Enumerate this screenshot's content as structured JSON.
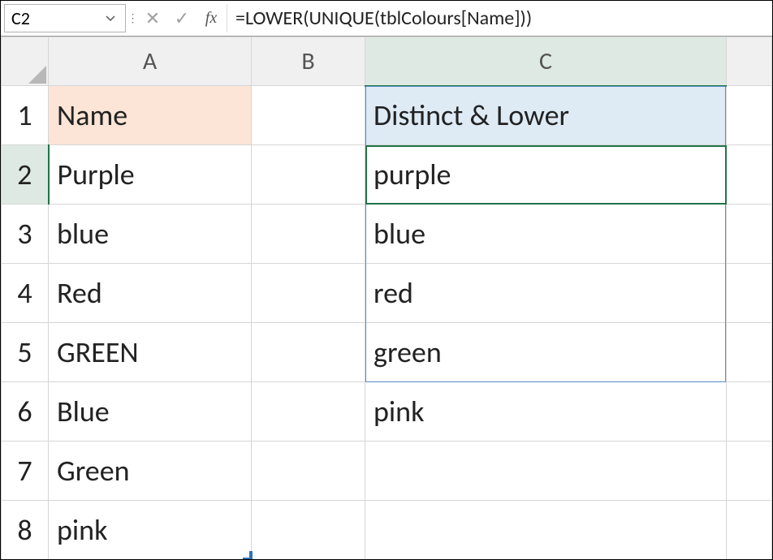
{
  "formula_bar": {
    "name_box": "C2",
    "cancel_icon": "✕",
    "confirm_icon": "✓",
    "fx_label": "fx",
    "formula": "=LOWER(UNIQUE(tblColours[Name]))"
  },
  "columns": {
    "A": "A",
    "B": "B",
    "C": "C"
  },
  "row_labels": [
    "1",
    "2",
    "3",
    "4",
    "5",
    "6",
    "7",
    "8"
  ],
  "headers": {
    "A": "Name",
    "C": "Distinct & Lower"
  },
  "data": {
    "A": [
      "Purple",
      "blue",
      "Red",
      "GREEN",
      "Blue",
      "Green",
      "pink"
    ],
    "C": [
      "purple",
      "blue",
      "red",
      "green",
      "pink"
    ]
  }
}
